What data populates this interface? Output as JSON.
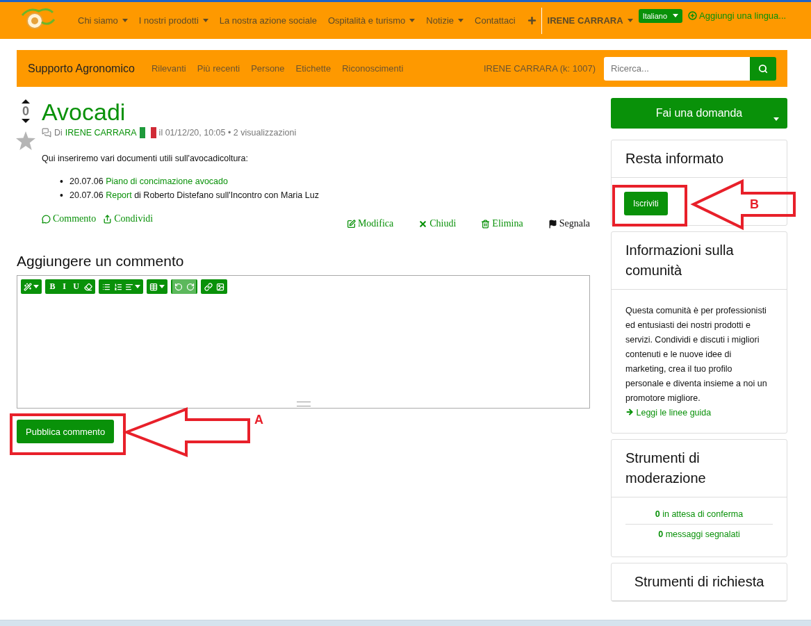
{
  "topnav": {
    "items": [
      {
        "label": "Chi siamo",
        "dropdown": true
      },
      {
        "label": "I nostri prodotti",
        "dropdown": true
      },
      {
        "label": "La nostra azione sociale",
        "dropdown": false
      },
      {
        "label": "Ospitalità e turismo",
        "dropdown": true
      },
      {
        "label": "Notizie",
        "dropdown": true
      },
      {
        "label": "Contattaci",
        "dropdown": false
      }
    ],
    "user": "IRENE CARRARA",
    "language": "Italiano",
    "add_language": "Aggiungi una lingua..."
  },
  "forum_bar": {
    "title": "Supporto Agronomico",
    "links": [
      "Rilevanti",
      "Più recenti",
      "Persone",
      "Etichette",
      "Riconoscimenti"
    ],
    "user_karma": "IRENE CARRARA (k: 1007)",
    "search": {
      "placeholder": "Ricerca..."
    }
  },
  "question": {
    "votes": "0",
    "favorite": false,
    "title": "Avocadi",
    "meta_prefix": "Di",
    "author": "IRENE CARRARA",
    "meta_rest": "il 01/12/20, 10:05 • 2 visualizzazioni",
    "intro": "Qui inseriremo vari documenti utili sull'avocadicoltura:",
    "bullets": [
      {
        "marker": "•",
        "date": "20.07.06",
        "link": "Piano di concimazione avocado"
      },
      {
        "marker": "•",
        "date": "20.07.06",
        "link": "Report",
        "rest": "di Roberto Distefano sull'Incontro con Maria Luz"
      }
    ],
    "left_actions": [
      {
        "kind": "comment",
        "label": "Commento"
      },
      {
        "kind": "share",
        "label": "Condividi"
      }
    ],
    "right_actions": [
      {
        "kind": "edit",
        "label": "Modifica"
      },
      {
        "kind": "close",
        "label": "Chiudi"
      },
      {
        "kind": "delete",
        "label": "Elimina"
      },
      {
        "kind": "flag",
        "label": "Segnala"
      }
    ]
  },
  "comment_form": {
    "heading": "Aggiungere un commento",
    "toolbar": [
      [
        {
          "kind": "style",
          "disabled": false
        }
      ],
      [
        {
          "kind": "text",
          "label": "B",
          "disabled": false
        },
        {
          "kind": "text",
          "label": "I",
          "disabled": false
        },
        {
          "kind": "text",
          "label": "U",
          "disabled": false
        },
        {
          "kind": "eraser",
          "disabled": false
        }
      ],
      [
        {
          "kind": "bullets",
          "disabled": false
        },
        {
          "kind": "numbers",
          "disabled": false
        },
        {
          "kind": "align",
          "disabled": false
        }
      ],
      [
        {
          "kind": "table",
          "disabled": false
        }
      ],
      [
        {
          "kind": "undo",
          "disabled": true
        },
        {
          "kind": "redo",
          "disabled": true
        }
      ],
      [
        {
          "kind": "link",
          "disabled": false
        },
        {
          "kind": "image",
          "disabled": false
        }
      ]
    ],
    "submit": "Pubblica commento"
  },
  "sidebar": {
    "ask_button": "Fai una domanda",
    "cards": [
      {
        "kind": "subscribe",
        "title": "Resta informato",
        "button": "Iscriviti"
      },
      {
        "kind": "info",
        "title": "Informazioni sulla comunità",
        "text": "Questa comunità è per professionisti ed entusiasti dei nostri prodotti e servizi. Condividi e discuti i migliori contenuti e le nuove idee di marketing, crea il tuo profilo personale e diventa insieme a noi un promotore migliore.",
        "link": "Leggi le linee guida"
      },
      {
        "kind": "moderation",
        "title": "Strumenti di moderazione",
        "items": [
          {
            "count": "0",
            "label": "in attesa di conferma"
          },
          {
            "count": "0",
            "label": "messaggi segnalati"
          }
        ]
      },
      {
        "kind": "heading",
        "title": "Strumenti di richiesta"
      }
    ]
  },
  "annotations": [
    {
      "label": "A"
    },
    {
      "label": "B"
    }
  ]
}
